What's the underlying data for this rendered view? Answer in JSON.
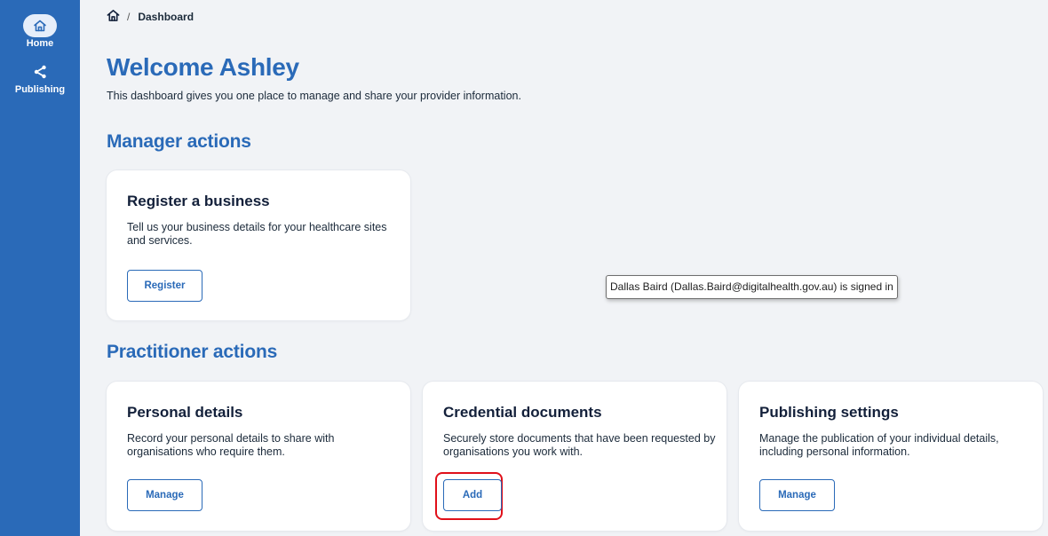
{
  "sidebar": {
    "items": [
      {
        "label": "Home",
        "icon": "home-icon",
        "active": true
      },
      {
        "label": "Publishing",
        "icon": "share-icon",
        "active": false
      }
    ]
  },
  "breadcrumb": {
    "home_icon": "home-icon",
    "separator": "/",
    "current": "Dashboard"
  },
  "header": {
    "title": "Welcome Ashley",
    "subtitle": "This dashboard gives you one place to manage and share your provider information."
  },
  "manager_section": {
    "title": "Manager actions",
    "cards": [
      {
        "title": "Register a business",
        "description": "Tell us your business details for your healthcare sites and services.",
        "button": "Register"
      }
    ]
  },
  "practitioner_section": {
    "title": "Practitioner actions",
    "cards": [
      {
        "title": "Personal details",
        "description": "Record your personal details to share with organisations who require them.",
        "button": "Manage"
      },
      {
        "title": "Credential documents",
        "description": "Securely store documents that have been requested by organisations you work with.",
        "button": "Add"
      },
      {
        "title": "Publishing settings",
        "description": "Manage the publication of your individual details, including personal information.",
        "button": "Manage"
      }
    ]
  },
  "tooltip": {
    "text": "Dallas Baird (Dallas.Baird@digitalhealth.gov.au) is signed in"
  },
  "colors": {
    "sidebar": "#2a6ab8",
    "accent": "#2a6ab8",
    "highlight": "#e0101a",
    "background": "#f1f3f6"
  }
}
